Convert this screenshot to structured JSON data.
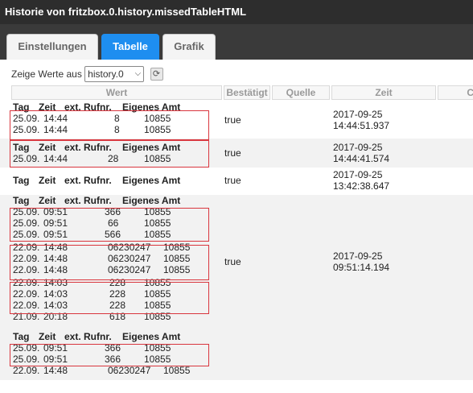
{
  "window": {
    "title": "Historie von fritzbox.0.history.missedTableHTML"
  },
  "tabs": [
    {
      "label": "Einstellungen"
    },
    {
      "label": "Tabelle"
    },
    {
      "label": "Grafik"
    }
  ],
  "toolbar": {
    "show_label": "Zeige Werte aus",
    "instance_value": "history.0",
    "chevron": "⌵",
    "refresh_glyph": "⟳"
  },
  "columns": {
    "wert": "Wert",
    "bestaetigt": "Bestätigt",
    "quelle": "Quelle",
    "zeit": "Zeit",
    "extra": "C"
  },
  "mini_header": {
    "tag": "Tag",
    "zeit": "Zeit",
    "rufnr": "ext. Rufnr.",
    "amt": "Eigenes Amt"
  },
  "rows": [
    {
      "ack": "true",
      "time_date": "2017-09-25",
      "time_clock": "14:44:51.937",
      "lines": [
        {
          "tag": "25.09.",
          "zeit": "14:44",
          "rufnr": "8",
          "amt": "10855"
        },
        {
          "tag": "25.09.",
          "zeit": "14:44",
          "rufnr": "8",
          "amt": "10855"
        }
      ]
    },
    {
      "ack": "true",
      "time_date": "2017-09-25",
      "time_clock": "14:44:41.574",
      "lines": [
        {
          "tag": "25.09.",
          "zeit": "14:44",
          "rufnr": "28",
          "amt": "10855"
        }
      ]
    },
    {
      "ack": "true",
      "time_date": "2017-09-25",
      "time_clock": "13:42:38.647",
      "lines": []
    },
    {
      "ack": "true",
      "time_date": "2017-09-25",
      "time_clock": "09:51:14.194",
      "lines": [
        {
          "tag": "25.09.",
          "zeit": "09:51",
          "rufnr": "366",
          "amt": "10855"
        },
        {
          "tag": "25.09.",
          "zeit": "09:51",
          "rufnr": "66",
          "amt": "10855"
        },
        {
          "tag": "25.09.",
          "zeit": "09:51",
          "rufnr": "566",
          "amt": "10855"
        },
        {
          "tag": "22.09.",
          "zeit": "14:48",
          "rufnr": "06230247",
          "amt": "10855"
        },
        {
          "tag": "22.09.",
          "zeit": "14:48",
          "rufnr": "06230247",
          "amt": "10855"
        },
        {
          "tag": "22.09.",
          "zeit": "14:48",
          "rufnr": "06230247",
          "amt": "10855"
        },
        {
          "tag": "22.09.",
          "zeit": "14:03",
          "rufnr": "228",
          "amt": "10855"
        },
        {
          "tag": "22.09.",
          "zeit": "14:03",
          "rufnr": "228",
          "amt": "10855"
        },
        {
          "tag": "22.09.",
          "zeit": "14:03",
          "rufnr": "228",
          "amt": "10855"
        },
        {
          "tag": "21.09.",
          "zeit": "20:18",
          "rufnr": "618",
          "amt": "10855"
        }
      ]
    },
    {
      "ack": "",
      "time_date": "",
      "time_clock": "",
      "lines": [
        {
          "tag": "25.09.",
          "zeit": "09:51",
          "rufnr": "366",
          "amt": "10855"
        },
        {
          "tag": "25.09.",
          "zeit": "09:51",
          "rufnr": "366",
          "amt": "10855"
        },
        {
          "tag": "22.09.",
          "zeit": "14:48",
          "rufnr": "06230247",
          "amt": "10855"
        }
      ]
    }
  ],
  "colors": {
    "accent": "#1e8ef0",
    "highlight_box": "#d9363e",
    "titlebar": "#2d2d2d"
  }
}
